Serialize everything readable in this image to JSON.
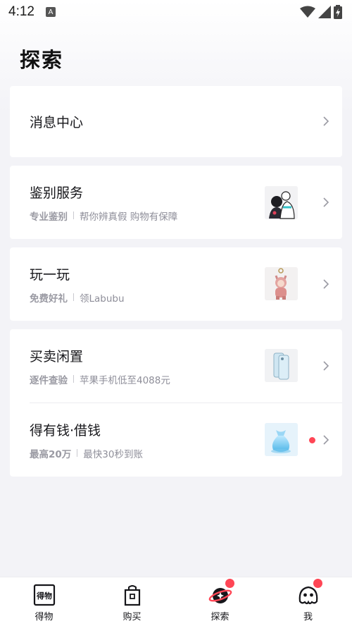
{
  "status_bar": {
    "time": "4:12",
    "app_icon": "a-app-icon"
  },
  "page": {
    "title": "探索"
  },
  "message_center": {
    "title": "消息中心"
  },
  "items": [
    {
      "title": "鉴别服务",
      "tag": "专业鉴别",
      "desc": "帮你辨真假 购物有保障",
      "thumb": "authentication-thumbnail"
    },
    {
      "title": "玩一玩",
      "tag": "免费好礼",
      "desc": "领Labubu",
      "thumb": "labubu-toy-thumbnail"
    },
    {
      "title": "买卖闲置",
      "tag": "逐件查验",
      "desc": "苹果手机低至4088元",
      "thumb": "iphone-thumbnail"
    },
    {
      "title": "得有钱·借钱",
      "tag": "最高20万",
      "desc": "最快30秒到账",
      "thumb": "money-bag-thumbnail"
    }
  ],
  "bottom_nav": [
    {
      "label": "得物",
      "icon": "dewu-logo-icon"
    },
    {
      "label": "购买",
      "icon": "shopping-bag-icon"
    },
    {
      "label": "探索",
      "icon": "planet-icon"
    },
    {
      "label": "我",
      "icon": "ghost-avatar-icon"
    }
  ],
  "colors": {
    "accent_red": "#ff4655",
    "background": "#f3f3f7"
  }
}
